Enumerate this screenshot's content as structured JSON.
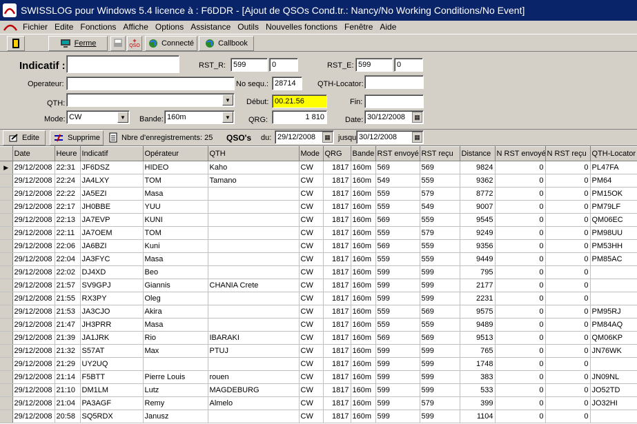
{
  "window": {
    "title": "SWISSLOG pour Windows 5.4 licence à : F6DDR - [Ajout de QSOs  Cond.tr.: Nancy/No Working Conditions/No Event]"
  },
  "menu": [
    "Fichier",
    "Edite",
    "Fonctions",
    "Affiche",
    "Options",
    "Assistance",
    "Outils",
    "Nouvelles fonctions",
    "Fenêtre",
    "Aide"
  ],
  "toolbar": {
    "ferme": "Ferme",
    "qso": "QSO",
    "connecte": "Connecté",
    "callbook": "Callbook"
  },
  "form": {
    "indicatif_label": "Indicatif :",
    "indicatif_value": "",
    "rst_r_label": "RST_R:",
    "rst_r_1": "599",
    "rst_r_2": "0",
    "rst_e_label": "RST_E:",
    "rst_e_1": "599",
    "rst_e_2": "0",
    "operateur_label": "Operateur:",
    "operateur_value": "",
    "no_sequ_label": "No sequ.:",
    "no_sequ_value": "28714",
    "qth_locator_label": "QTH-Locator:",
    "qth_locator_value": "",
    "qth_label": "QTH:",
    "qth_value": "",
    "debut_label": "Début:",
    "debut_value": "00.21.56",
    "fin_label": "Fin:",
    "fin_value": "",
    "mode_label": "Mode:",
    "mode_value": "CW",
    "bande_label": "Bande:",
    "bande_value": "160m",
    "qrg_label": "QRG:",
    "qrg_value": "1 810",
    "date_label": "Date:",
    "date_value": "30/12/2008"
  },
  "subbar": {
    "edite": "Edite",
    "supprime": "Supprime",
    "nbre": "Nbre d'enregistrements: 25",
    "qsos": "QSO's",
    "du_label": "du:",
    "du_value": "29/12/2008",
    "jusqu_label": "jusqu",
    "jusqu_value": "30/12/2008"
  },
  "grid": {
    "columns": [
      "Date",
      "Heure",
      "Indicatif",
      "Opérateur",
      "QTH",
      "Mode",
      "QRG",
      "Bande",
      "RST envoyé",
      "RST reçu",
      "Distance",
      "N RST envoyé",
      "N RST reçu",
      "QTH-Locator"
    ],
    "rows": [
      [
        "29/12/2008",
        "22:31",
        "JF6DSZ",
        "HIDEO",
        "Kaho",
        "CW",
        "1817",
        "160m",
        "569",
        "569",
        "9824",
        "0",
        "0",
        "PL47FA"
      ],
      [
        "29/12/2008",
        "22:24",
        "JA4LXY",
        "TOM",
        "Tamano",
        "CW",
        "1817",
        "160m",
        "549",
        "559",
        "9362",
        "0",
        "0",
        "PM64"
      ],
      [
        "29/12/2008",
        "22:22",
        "JA5EZI",
        "Masa",
        "",
        "CW",
        "1817",
        "160m",
        "559",
        "579",
        "8772",
        "0",
        "0",
        "PM15OK"
      ],
      [
        "29/12/2008",
        "22:17",
        "JH0BBE",
        "YUU",
        "",
        "CW",
        "1817",
        "160m",
        "559",
        "549",
        "9007",
        "0",
        "0",
        "PM79LF"
      ],
      [
        "29/12/2008",
        "22:13",
        "JA7EVP",
        "KUNI",
        "",
        "CW",
        "1817",
        "160m",
        "569",
        "559",
        "9545",
        "0",
        "0",
        "QM06EC"
      ],
      [
        "29/12/2008",
        "22:11",
        "JA7OEM",
        "TOM",
        "",
        "CW",
        "1817",
        "160m",
        "559",
        "579",
        "9249",
        "0",
        "0",
        "PM98UU"
      ],
      [
        "29/12/2008",
        "22:06",
        "JA6BZI",
        "Kuni",
        "",
        "CW",
        "1817",
        "160m",
        "569",
        "559",
        "9356",
        "0",
        "0",
        "PM53HH"
      ],
      [
        "29/12/2008",
        "22:04",
        "JA3FYC",
        "Masa",
        "",
        "CW",
        "1817",
        "160m",
        "559",
        "559",
        "9449",
        "0",
        "0",
        "PM85AC"
      ],
      [
        "29/12/2008",
        "22:02",
        "DJ4XD",
        "Beo",
        "",
        "CW",
        "1817",
        "160m",
        "599",
        "599",
        "795",
        "0",
        "0",
        ""
      ],
      [
        "29/12/2008",
        "21:57",
        "SV9GPJ",
        "Giannis",
        "CHANIA Crete",
        "CW",
        "1817",
        "160m",
        "599",
        "599",
        "2177",
        "0",
        "0",
        ""
      ],
      [
        "29/12/2008",
        "21:55",
        "RX3PY",
        "Oleg",
        "",
        "CW",
        "1817",
        "160m",
        "599",
        "599",
        "2231",
        "0",
        "0",
        ""
      ],
      [
        "29/12/2008",
        "21:53",
        "JA3CJO",
        "Akira",
        "",
        "CW",
        "1817",
        "160m",
        "559",
        "569",
        "9575",
        "0",
        "0",
        "PM95RJ"
      ],
      [
        "29/12/2008",
        "21:47",
        "JH3PRR",
        "Masa",
        "",
        "CW",
        "1817",
        "160m",
        "559",
        "559",
        "9489",
        "0",
        "0",
        "PM84AQ"
      ],
      [
        "29/12/2008",
        "21:39",
        "JA1JRK",
        "Rio",
        "IBARAKI",
        "CW",
        "1817",
        "160m",
        "569",
        "569",
        "9513",
        "0",
        "0",
        "QM06KP"
      ],
      [
        "29/12/2008",
        "21:32",
        "S57AT",
        "Max",
        "PTUJ",
        "CW",
        "1817",
        "160m",
        "599",
        "599",
        "765",
        "0",
        "0",
        "JN76WK"
      ],
      [
        "29/12/2008",
        "21:29",
        "UY2UQ",
        "",
        "",
        "CW",
        "1817",
        "160m",
        "599",
        "599",
        "1748",
        "0",
        "0",
        ""
      ],
      [
        "29/12/2008",
        "21:14",
        "F5BTT",
        "Pierre Louis",
        "rouen",
        "CW",
        "1817",
        "160m",
        "599",
        "599",
        "383",
        "0",
        "0",
        "JN09NL"
      ],
      [
        "29/12/2008",
        "21:10",
        "DM1LM",
        "Lutz",
        "MAGDEBURG",
        "CW",
        "1817",
        "160m",
        "599",
        "599",
        "533",
        "0",
        "0",
        "JO52TD"
      ],
      [
        "29/12/2008",
        "21:04",
        "PA3AGF",
        "Remy",
        "Almelo",
        "CW",
        "1817",
        "160m",
        "599",
        "579",
        "399",
        "0",
        "0",
        "JO32HI"
      ],
      [
        "29/12/2008",
        "20:58",
        "SQ5RDX",
        "Janusz",
        "",
        "CW",
        "1817",
        "160m",
        "599",
        "599",
        "1104",
        "0",
        "0",
        ""
      ]
    ]
  },
  "colors": {
    "titlebar": "#0a246a",
    "window": "#d4d0c8",
    "highlight": "#ffff00"
  }
}
